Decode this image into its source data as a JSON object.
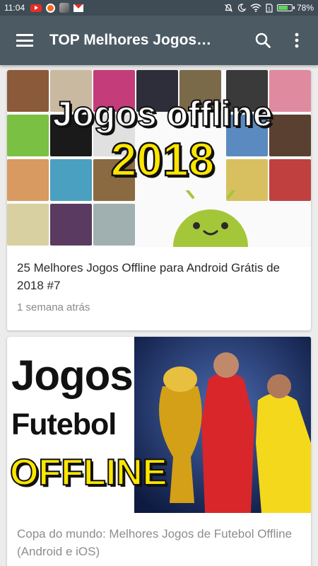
{
  "status_bar": {
    "time": "11:04",
    "battery": "78%",
    "battery_level": 0.78,
    "icons": [
      "youtube-icon",
      "app-ring-icon",
      "app-icon",
      "gmail-icon",
      "mute-icon",
      "moon-icon",
      "wifi-icon",
      "sim-icon",
      "battery-icon"
    ]
  },
  "app_bar": {
    "title": "TOP Melhores Jogos…",
    "menu_icon": "hamburger-menu-icon",
    "search_icon": "search-icon",
    "more_icon": "more-vert-icon",
    "color": "#4c5a64"
  },
  "cards": [
    {
      "thumbnail_text_line1": "Jogos offline",
      "thumbnail_text_line2": "2018",
      "title": "25 Melhores Jogos Offline para Android Grátis de 2018 #7",
      "time": "1 semana atrás"
    },
    {
      "thumbnail_text_line1": "Jogos",
      "thumbnail_text_line2": "Futebol",
      "thumbnail_text_line3": "OFFLINE",
      "title": "Copa do mundo: Melhores Jogos de Futebol Offline (Android e iOS)"
    }
  ],
  "colors": {
    "status_bar": "#3f4c55",
    "accent_yellow": "#ffe600",
    "android_green": "#a4c639"
  }
}
